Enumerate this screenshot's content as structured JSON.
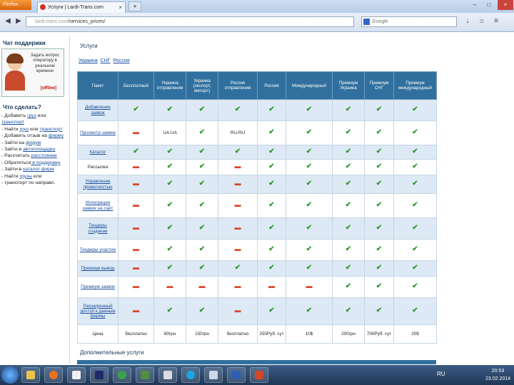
{
  "browser": {
    "app_button": "Firefox",
    "tab_title": "Услуги | Lardi-Trans.com",
    "url_host": "lardi-trans.com",
    "url_path": "/services_prices/",
    "search_placeholder": "Google"
  },
  "sidebar": {
    "chat_title": "Чат поддержки",
    "chat_text": "Задать вопрос оператору в реальном времени",
    "chat_status": "[offline]",
    "todo_title": "Что сделать?",
    "todo_items": [
      {
        "parts": [
          "Добавить ",
          "груз",
          " или ",
          "транспорт",
          ""
        ]
      },
      {
        "parts": [
          "Найти ",
          "груз",
          " или ",
          "транспорт",
          ""
        ]
      },
      {
        "parts": [
          "Добавить отзыв на ",
          "",
          "",
          "",
          "фирму"
        ]
      },
      {
        "parts": [
          "Зайти на ",
          "форум",
          "",
          "",
          ""
        ]
      },
      {
        "parts": [
          "Зайти в ",
          "автоплощадку",
          "",
          "",
          ""
        ]
      },
      {
        "parts": [
          "Рассчитать ",
          "расстояние",
          "",
          "",
          ""
        ]
      },
      {
        "parts": [
          "Обратиться",
          " в поддержку",
          "",
          "",
          ""
        ]
      },
      {
        "parts": [
          "Зайти в ",
          "каталог фирм",
          "",
          "",
          ""
        ]
      },
      {
        "parts": [
          "Найти ",
          "грузы",
          " или ",
          "",
          ""
        ]
      },
      {
        "parts": [
          "транспорт по направл.",
          "",
          "",
          "",
          ""
        ]
      }
    ]
  },
  "main": {
    "title": "Услуги",
    "subtabs": [
      "Украина",
      "СНГ",
      "Россия"
    ],
    "columns": [
      "Пакет",
      "Бесплатный",
      "Украина отправления",
      "Украина (экспорт, импорт)",
      "Россия отправления",
      "Россия",
      "Международный",
      "Премиум Украина",
      "Премиум СНГ",
      "Премиум международный"
    ],
    "rows": [
      {
        "name": "Добавление заявок",
        "link": true,
        "cells": [
          "ok",
          "ok",
          "ok",
          "ok",
          "ok",
          "ok",
          "ok",
          "ok",
          "ok"
        ]
      },
      {
        "name": "Просмотр заявок",
        "link": true,
        "cells": [
          "no",
          "UA-UA",
          "ok",
          "RU-RU",
          "ok",
          "ok",
          "ok",
          "ok",
          "ok"
        ]
      },
      {
        "name": "Каталог",
        "link": true,
        "cells": [
          "ok",
          "ok",
          "ok",
          "ok",
          "ok",
          "ok",
          "ok",
          "ok",
          "ok"
        ]
      },
      {
        "name": "Рассылка",
        "link": false,
        "cells": [
          "no",
          "ok",
          "ok",
          "no",
          "ok",
          "ok",
          "ok",
          "ok",
          "ok"
        ]
      },
      {
        "name": "Управление приватностью",
        "link": true,
        "cells": [
          "no",
          "ok",
          "ok",
          "no",
          "ok",
          "ok",
          "ok",
          "ok",
          "ok"
        ]
      },
      {
        "name": "Интеграция заявок на сайт",
        "link": true,
        "cells": [
          "no",
          "ok",
          "ok",
          "no",
          "ok",
          "ok",
          "ok",
          "ok",
          "ok"
        ]
      },
      {
        "name": "Тендеры создание",
        "link": true,
        "cells": [
          "no",
          "ok",
          "ok",
          "no",
          "ok",
          "ok",
          "ok",
          "ok",
          "ok"
        ]
      },
      {
        "name": "Тендеры участие",
        "link": true,
        "cells": [
          "no",
          "ok",
          "ok",
          "no",
          "ok",
          "ok",
          "ok",
          "ok",
          "ok"
        ]
      },
      {
        "name": "Премиум вывод",
        "link": true,
        "cells": [
          "no",
          "ok",
          "ok",
          "ok",
          "ok",
          "ok",
          "ok",
          "ok",
          "ok"
        ]
      },
      {
        "name": "Премиум заявок",
        "link": true,
        "cells": [
          "no",
          "no",
          "no",
          "no",
          "no",
          "no",
          "ok",
          "ok",
          "ok"
        ]
      },
      {
        "name": "Расширенный доступ к данным фирмы",
        "link": true,
        "cells": [
          "no",
          "ok",
          "ok",
          "no",
          "ok",
          "ok",
          "ok",
          "ok",
          "ok"
        ]
      },
      {
        "name": "Цена",
        "link": false,
        "cells": [
          "бесплатно",
          "80грн",
          "150грн",
          "бесплатно",
          "250Руб. сут",
          "10$",
          "200грн",
          "700Руб. сут",
          "20$"
        ]
      }
    ],
    "extra_title": "Дополнительные услуги"
  },
  "taskbar": {
    "lang": "RU",
    "time": "20:53",
    "date": "23.02.2014"
  },
  "colors": {
    "header_blue": "#31709e",
    "row_tint": "#dde9f4",
    "check_green": "#2f9a2f",
    "cross_red": "#d8472b"
  }
}
